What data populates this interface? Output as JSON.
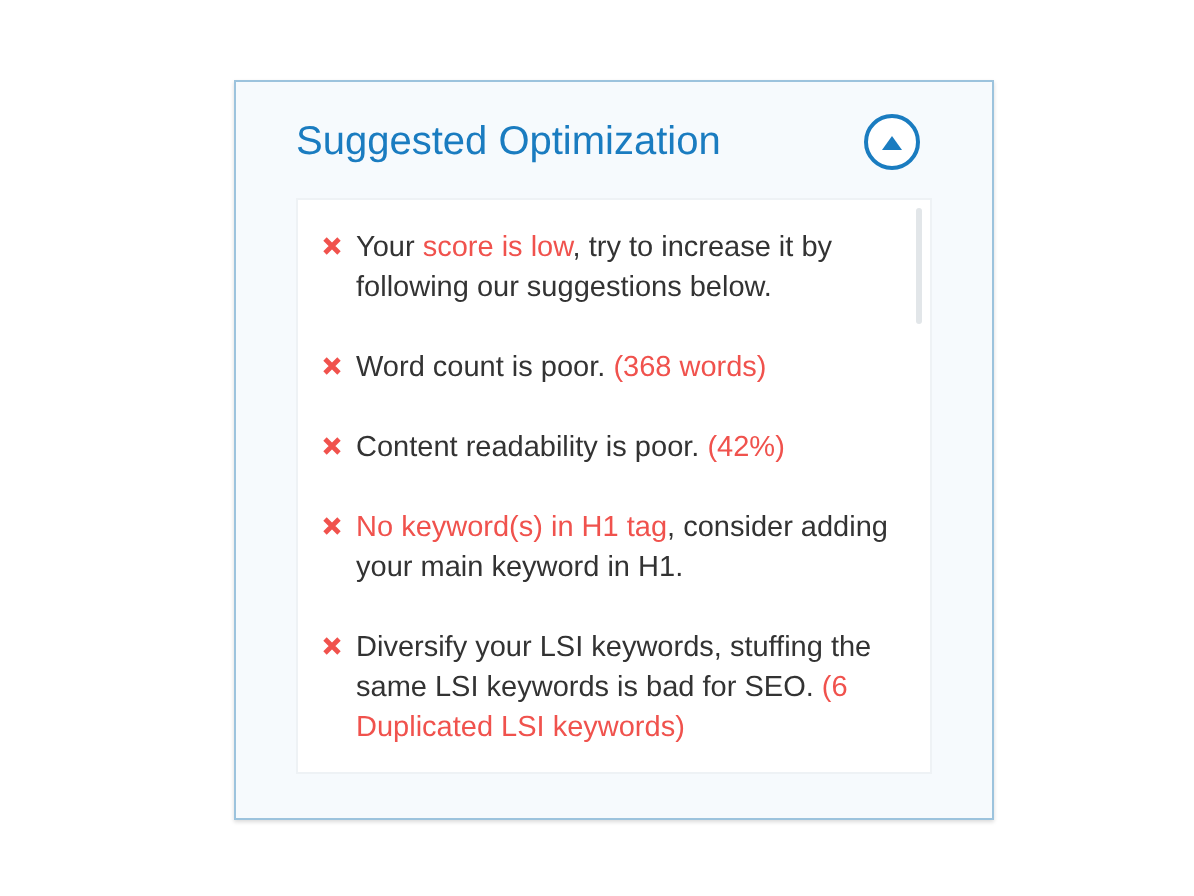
{
  "panel": {
    "title": "Suggested Optimization",
    "expanded": true
  },
  "suggestions": [
    {
      "segments": [
        {
          "text": "Your ",
          "highlight": false
        },
        {
          "text": "score is low",
          "highlight": true
        },
        {
          "text": ", try to increase it by following our suggestions below.",
          "highlight": false
        }
      ]
    },
    {
      "segments": [
        {
          "text": "Word count is poor. ",
          "highlight": false
        },
        {
          "text": "(368 words)",
          "highlight": true
        }
      ]
    },
    {
      "segments": [
        {
          "text": "Content readability is poor. ",
          "highlight": false
        },
        {
          "text": "(42%)",
          "highlight": true
        }
      ]
    },
    {
      "segments": [
        {
          "text": "No keyword(s) in H1 tag",
          "highlight": true
        },
        {
          "text": ", consider adding your main keyword in H1.",
          "highlight": false
        }
      ]
    },
    {
      "segments": [
        {
          "text": "Diversify your LSI keywords, stuffing the same LSI keywords is bad for SEO. ",
          "highlight": false
        },
        {
          "text": "(6 Duplicated LSI keywords)",
          "highlight": true
        }
      ]
    }
  ]
}
